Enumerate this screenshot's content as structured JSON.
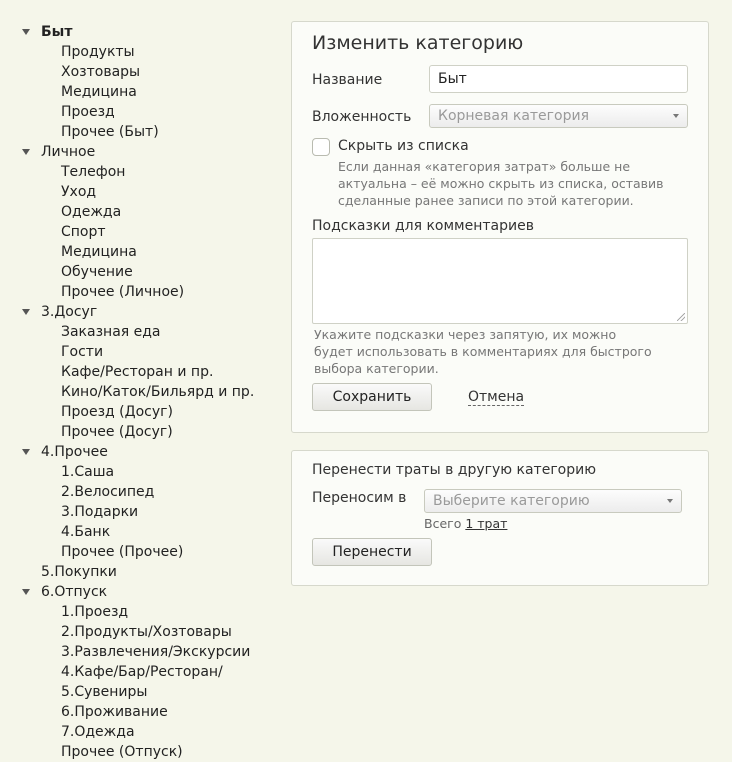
{
  "tree": [
    {
      "label": "Быт",
      "selected": true,
      "children": [
        "Продукты",
        "Хозтовары",
        "Медицина",
        "Проезд",
        "Прочее (Быт)"
      ]
    },
    {
      "label": "Личное",
      "children": [
        "Телефон",
        "Уход",
        "Одежда",
        "Спорт",
        "Медицина",
        "Обучение",
        "Прочее (Личное)"
      ]
    },
    {
      "label": "3.Досуг",
      "children": [
        "Заказная еда",
        "Гости",
        "Кафе/Ресторан и пр.",
        "Кино/Каток/Бильярд и пр.",
        "Проезд (Досуг)",
        "Прочее (Досуг)"
      ]
    },
    {
      "label": "4.Прочее",
      "children": [
        "1.Саша",
        "2.Велосипед",
        "3.Подарки",
        "4.Банк",
        "Прочее (Прочее)"
      ]
    },
    {
      "label": "5.Покупки",
      "children": []
    },
    {
      "label": "6.Отпуск",
      "children": [
        "1.Проезд",
        "2.Продукты/Хозтовары",
        "3.Развлечения/Экскурсии",
        "4.Кафе/Бар/Ресторан/",
        "5.Сувениры",
        "6.Проживание",
        "7.Одежда",
        "Прочее (Отпуск)"
      ]
    }
  ],
  "edit": {
    "title": "Изменить категорию",
    "name_label": "Название",
    "name_value": "Быт",
    "parent_label": "Вложенность",
    "parent_value": "Корневая категория",
    "hide_label": "Скрыть из списка",
    "hide_hint_1": "Если данная «категория затрат» больше не",
    "hide_hint_2": "актуальна – её можно скрыть из списка, оставив",
    "hide_hint_3": "сделанные ранее записи по этой категории.",
    "hints_label": "Подсказки для комментариев",
    "hints_value": "",
    "hints_hint_1": "Укажите подсказки через запятую, их можно",
    "hints_hint_2": "будет использовать в комментариях для быстрого",
    "hints_hint_3": "выбора категории.",
    "save_label": "Сохранить",
    "cancel_label": "Отмена"
  },
  "move": {
    "title": "Перенести траты в другую категорию",
    "target_label": "Переносим в",
    "target_placeholder": "Выберите категорию",
    "total_prefix": "Всего",
    "total_link": "1 трат",
    "move_label": "Перенести"
  },
  "colors": {
    "page_bg": "#f5f6ea",
    "panel_bg": "#fbfcf8"
  }
}
